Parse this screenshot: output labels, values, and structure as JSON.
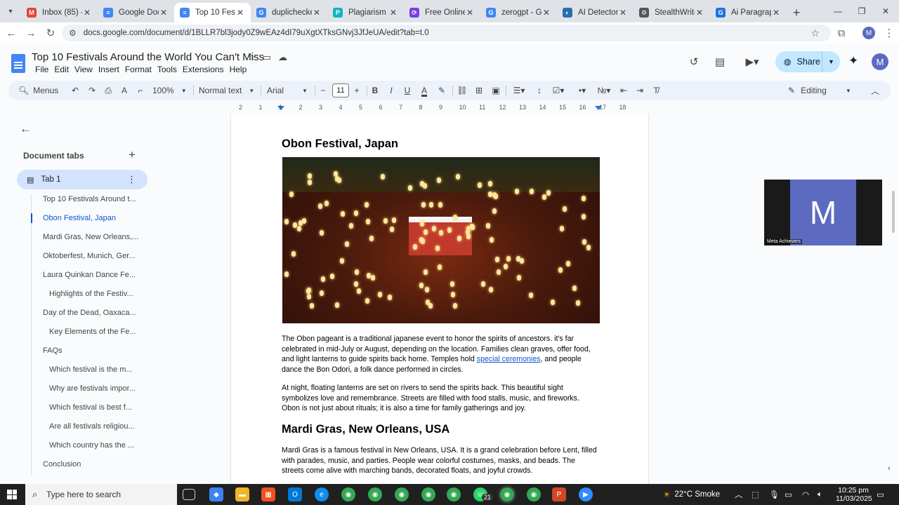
{
  "browser": {
    "tabs": [
      {
        "title": "Inbox (85) - m",
        "color": "#ea4335",
        "glyph": "M"
      },
      {
        "title": "Google Docs",
        "color": "#4285f4",
        "glyph": "≡"
      },
      {
        "title": "Top 10 Festiv",
        "color": "#4285f4",
        "glyph": "≡",
        "active": true
      },
      {
        "title": "duplichecker",
        "color": "#4285f4",
        "glyph": "G"
      },
      {
        "title": "Plagiarism Ch",
        "color": "#0fb5c2",
        "glyph": "P"
      },
      {
        "title": "Free Online R",
        "color": "#7b3fe4",
        "glyph": "⟳"
      },
      {
        "title": "zerogpt - Goo",
        "color": "#4285f4",
        "glyph": "G"
      },
      {
        "title": "AI Detector -",
        "color": "#2b6cb0",
        "glyph": "◐"
      },
      {
        "title": "StealthWriter",
        "color": "#555555",
        "glyph": "⚙"
      },
      {
        "title": "Ai Paragraph",
        "color": "#1a73e8",
        "glyph": "G"
      }
    ],
    "url": "docs.google.com/document/d/1BLLR7bl3jody0Z9wEAz4dI79uXgtXTksGNvj3JfJeUA/edit?tab=t.0"
  },
  "docs": {
    "title": "Top 10 Festivals Around the World You Can't Miss",
    "menus": [
      "File",
      "Edit",
      "View",
      "Insert",
      "Format",
      "Tools",
      "Extensions",
      "Help"
    ],
    "share_label": "Share",
    "avatar_letter": "M"
  },
  "toolbar": {
    "menus_label": "Menus",
    "zoom": "100%",
    "style": "Normal text",
    "font": "Arial",
    "font_size": "11",
    "mode": "Editing"
  },
  "ruler": [
    "2",
    "1",
    "1",
    "2",
    "3",
    "4",
    "5",
    "6",
    "7",
    "8",
    "9",
    "10",
    "11",
    "12",
    "13",
    "14",
    "15",
    "16",
    "17",
    "18"
  ],
  "sidepanel": {
    "title": "Document tabs",
    "tab_label": "Tab 1",
    "outline": [
      {
        "text": "Top 10 Festivals Around t...",
        "level": 1
      },
      {
        "text": "Obon Festival, Japan",
        "level": 1,
        "active": true
      },
      {
        "text": "Mardi Gras, New Orleans,...",
        "level": 1
      },
      {
        "text": "Oktoberfest, Munich, Ger...",
        "level": 1
      },
      {
        "text": "Laura Quinkan Dance Fe...",
        "level": 1
      },
      {
        "text": "Highlights of the Festiv...",
        "level": 2
      },
      {
        "text": "Day of the Dead, Oaxaca...",
        "level": 1
      },
      {
        "text": "Key Elements of the Fe...",
        "level": 2
      },
      {
        "text": "FAQs",
        "level": 1
      },
      {
        "text": "Which festival is the m...",
        "level": 2
      },
      {
        "text": "Why are festivals impor...",
        "level": 2
      },
      {
        "text": "Which festival is best f...",
        "level": 2
      },
      {
        "text": "Are all festivals religiou...",
        "level": 2
      },
      {
        "text": "Which country has the ...",
        "level": 2
      },
      {
        "text": "Conclusion",
        "level": 1
      }
    ]
  },
  "page": {
    "heading1": "Obon Festival, Japan",
    "para1_a": "The Obon pageant is a traditional japanese event to honor the spirits of ancestors. it's far celebrated in mid-July or August, depending on the location. Families clean graves, offer food, and light lanterns to guide spirits back home. Temples hold ",
    "para1_link": "special ceremonies",
    "para1_b": ", and people dance the Bon Odori, a folk dance performed in circles.",
    "para2": "At night, floating lanterns are set on rivers to send the spirits back. This beautiful sight symbolizes love and remembrance. Streets are filled with food stalls, music, and fireworks. Obon is not just about rituals; it is also a time for family gatherings and joy.",
    "heading2": "Mardi Gras, New Orleans, USA",
    "para3": "Mardi Gras is a famous festival in New Orleans, USA. It is a grand celebration before Lent, filled with parades, music, and parties. People wear colorful costumes, masks, and beads. The streets come alive with marching bands, decorated floats, and joyful crowds."
  },
  "video": {
    "letter": "M",
    "name": "Meta Achievers"
  },
  "taskbar": {
    "search_placeholder": "Type here to search",
    "whatsapp_badge": "21",
    "weather": "22°C  Smoke",
    "time": "10:25 pm",
    "date": "11/03/2025"
  }
}
